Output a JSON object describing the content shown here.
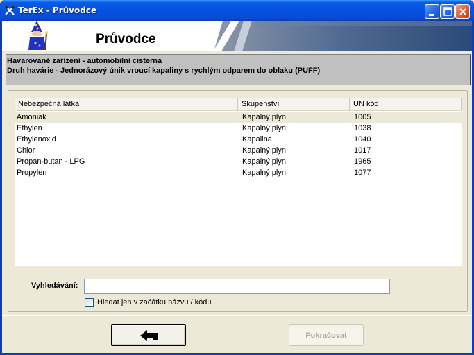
{
  "window": {
    "title": "TerEx  - Průvodce"
  },
  "banner": {
    "title": "Průvodce"
  },
  "info": {
    "line1": "Havarované zařízení - automobilní cisterna",
    "line2": "Druh havárie - Jednorázový únik vroucí kapaliny s rychlým odparem do oblaku  (PUFF)"
  },
  "table": {
    "columns": [
      "Nebezpečná látka",
      "Skupenství",
      "UN kód"
    ],
    "rows": [
      {
        "substance": "Amoniak",
        "state": "Kapalný plyn",
        "un": "1005",
        "selected": true
      },
      {
        "substance": "Ethylen",
        "state": "Kapalný plyn",
        "un": "1038"
      },
      {
        "substance": "Ethylenoxid",
        "state": "Kapalina",
        "un": "1040"
      },
      {
        "substance": "Chlor",
        "state": "Kapalný plyn",
        "un": "1017"
      },
      {
        "substance": "Propan-butan - LPG",
        "state": "Kapalný plyn",
        "un": "1965"
      },
      {
        "substance": "Propylen",
        "state": "Kapalný plyn",
        "un": "1077"
      }
    ]
  },
  "search": {
    "label": "Vyhledávání:",
    "value": "",
    "checkbox_label": "Hledat jen v začátku názvu / kódu",
    "checkbox_checked": false
  },
  "buttons": {
    "next_label": "Pokračovat",
    "back_icon": "arrow-left-icon"
  },
  "colors": {
    "titlebar": "#0453e0",
    "banner_accent": "#3b5a8a",
    "info_background": "#c0c0c0"
  }
}
